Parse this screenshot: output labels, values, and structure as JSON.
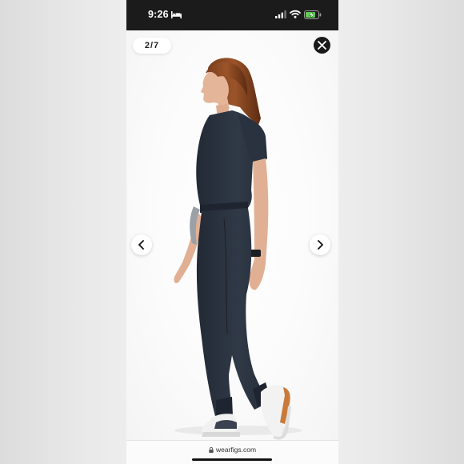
{
  "status_bar": {
    "time": "9:26",
    "icons": [
      "bed-icon",
      "signal-icon",
      "wifi-icon",
      "battery-charging-icon"
    ]
  },
  "gallery": {
    "counter": "2/7",
    "close_icon": "close-icon",
    "prev_icon": "chevron-left-icon",
    "next_icon": "chevron-right-icon"
  },
  "browser": {
    "url": "wearfigs.com",
    "lock_icon": "lock-icon"
  },
  "colors": {
    "jumpsuit": "#2b3340",
    "battery": "#5ed14f",
    "status_bar": "#1b1b1b"
  }
}
